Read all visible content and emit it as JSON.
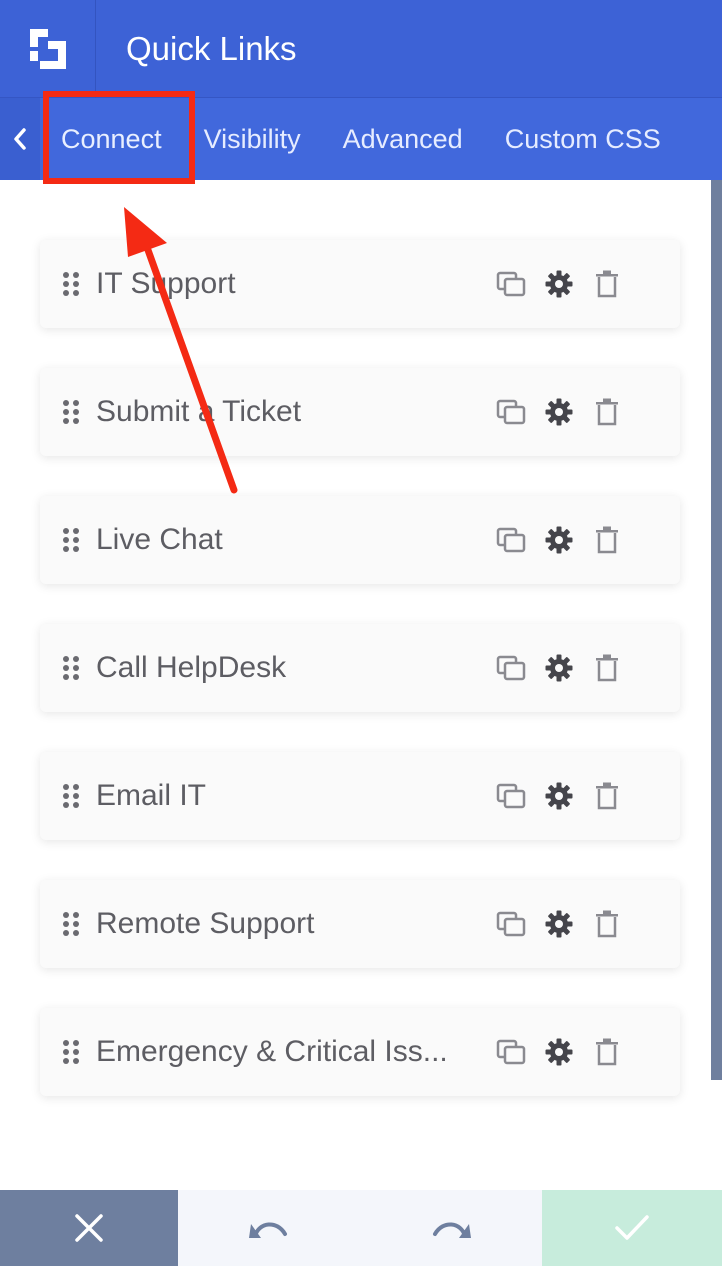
{
  "header": {
    "title": "Quick Links",
    "logo_icon": "brand-logo-icon"
  },
  "tabs": [
    {
      "label": "Connect",
      "active": true
    },
    {
      "label": "Visibility"
    },
    {
      "label": "Advanced"
    },
    {
      "label": "Custom CSS"
    }
  ],
  "items": [
    {
      "label": "IT Support"
    },
    {
      "label": "Submit a Ticket"
    },
    {
      "label": "Live Chat"
    },
    {
      "label": "Call HelpDesk"
    },
    {
      "label": "Email IT"
    },
    {
      "label": "Remote Support"
    },
    {
      "label": "Emergency & Critical Iss..."
    }
  ],
  "item_actions": [
    "duplicate-icon",
    "gear-icon",
    "trash-icon"
  ],
  "bottom": [
    "close-icon",
    "undo-icon",
    "redo-icon",
    "checkmark-icon"
  ],
  "colors": {
    "header_bg": "#3d62d6",
    "tabbar_bg": "#4168dc",
    "annotation": "#f42a14",
    "save_bg": "#c7ecdc",
    "close_bg": "#6e7f9f"
  }
}
